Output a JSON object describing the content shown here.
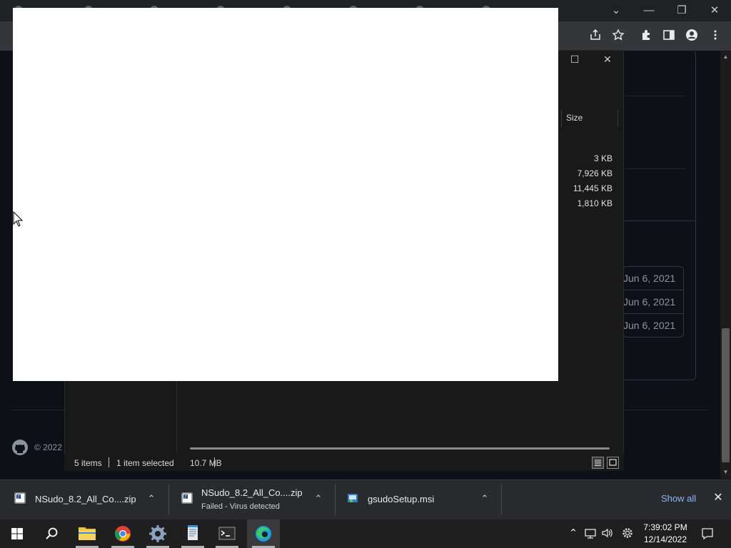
{
  "browser": {
    "window_controls": {
      "minimize": "—",
      "restore": "❐",
      "close": "✕",
      "tab_search": "⌄"
    },
    "toolbar_icons": [
      "share-icon",
      "star-icon",
      "extensions-icon",
      "side-panel-icon",
      "profile-icon",
      "menu-icon"
    ]
  },
  "github_page": {
    "release_dates": [
      "Jun 6, 2021",
      "Jun 6, 2021",
      "Jun 6, 2021"
    ],
    "footer_copyright": "© 2022"
  },
  "explorer": {
    "column_header": "Size",
    "file_sizes": [
      "3 KB",
      "7,926 KB",
      "11,445 KB",
      "1,810 KB"
    ],
    "status": {
      "item_count": "5 items",
      "selection": "1 item selected",
      "selection_size": "10.7 MB"
    },
    "controls": {
      "maximize": "☐",
      "close": "✕"
    }
  },
  "downloads": {
    "items": [
      {
        "name": "NSudo_8.2_All_Co....zip",
        "status": ""
      },
      {
        "name": "NSudo_8.2_All_Co....zip",
        "status": "Failed - Virus detected"
      },
      {
        "name": "gsudoSetup.msi",
        "status": ""
      }
    ],
    "show_all": "Show all",
    "close": "✕"
  },
  "taskbar": {
    "time": "7:39:02 PM",
    "date": "12/14/2022",
    "apps": [
      "start",
      "search",
      "file-explorer",
      "chrome",
      "settings",
      "notepad",
      "terminal",
      "edge"
    ]
  },
  "colors": {
    "page_bg": "#0d1117",
    "browser_chrome": "#35363a",
    "taskbar": "#1f1f1f",
    "link_blue": "#8ab4f8"
  }
}
